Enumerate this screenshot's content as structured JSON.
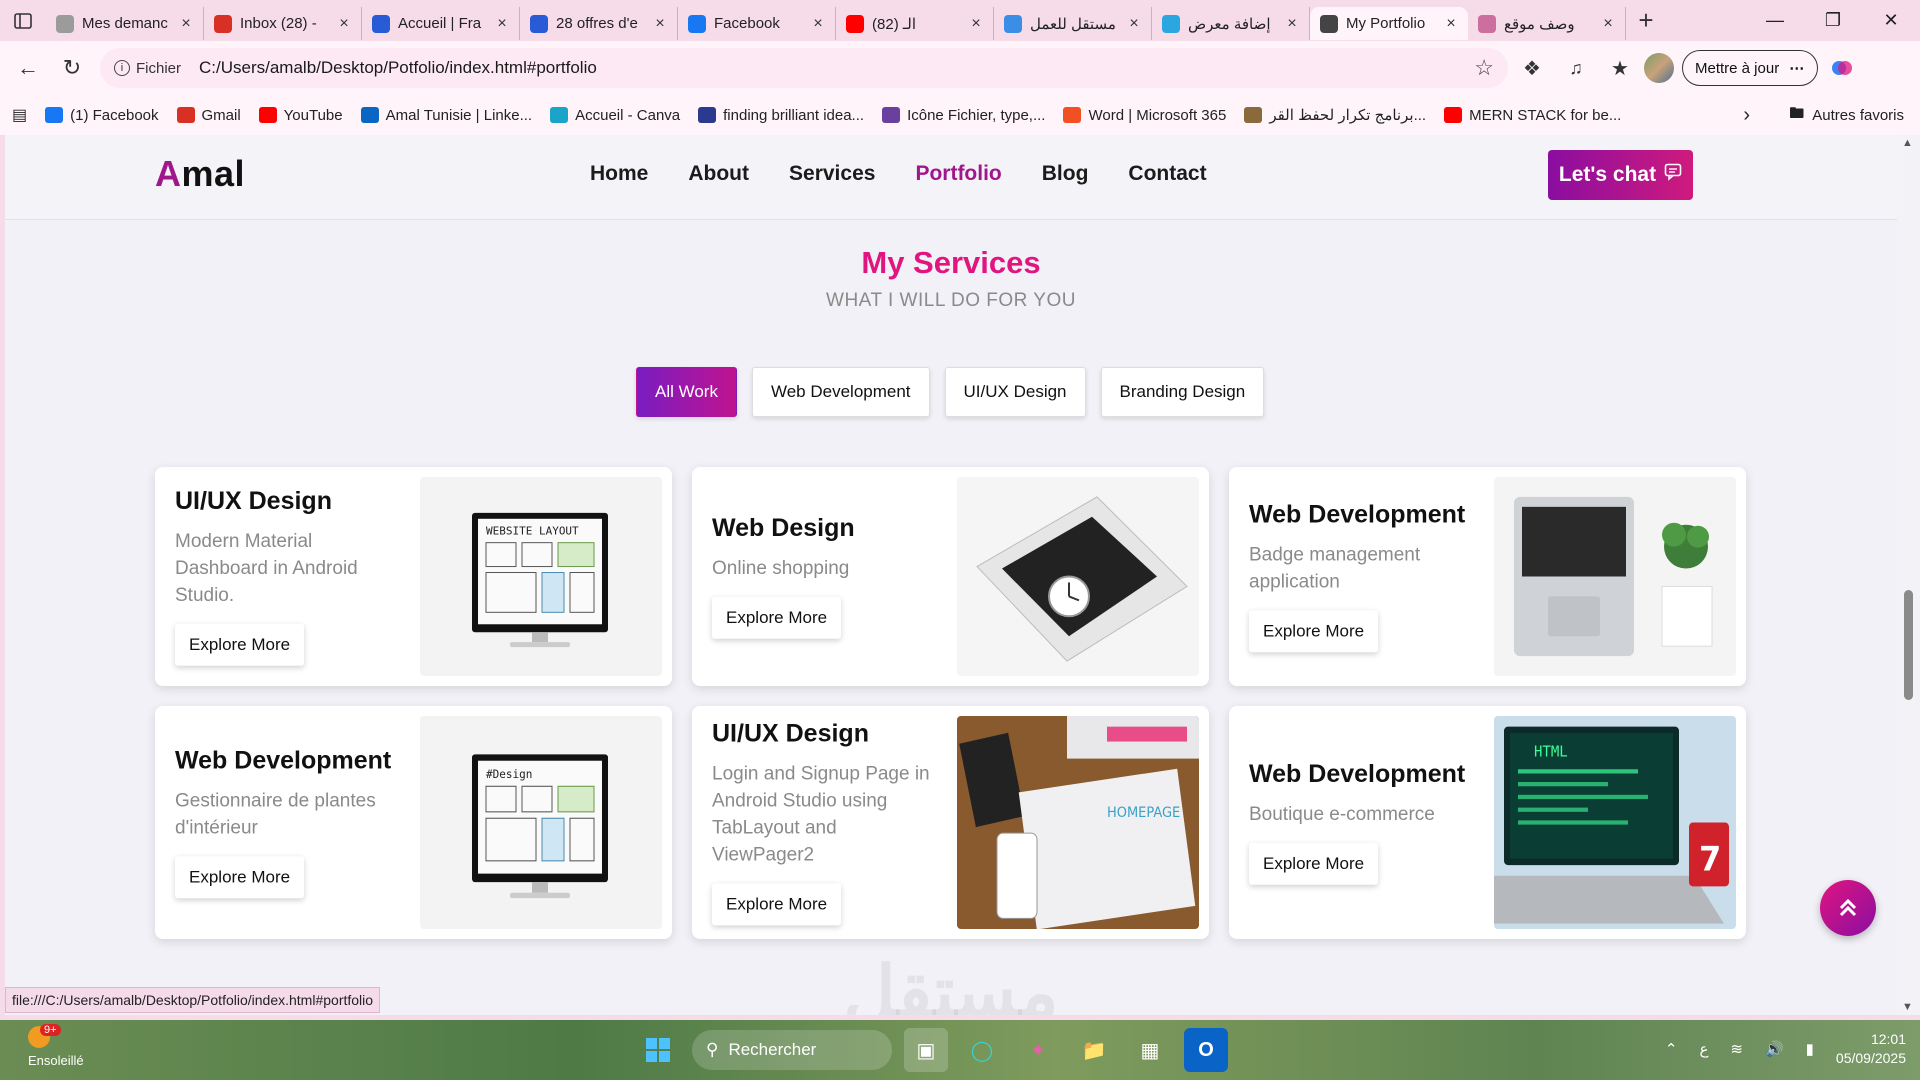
{
  "browser": {
    "tabs": [
      {
        "title": "Mes demanc",
        "icon": "settings-tab-icon",
        "color": "#9b9b9b"
      },
      {
        "title": "Inbox (28) -",
        "icon": "gmail-icon",
        "color": "#d93025"
      },
      {
        "title": "Accueil | Fra",
        "icon": "network-icon",
        "color": "#2a5bd7"
      },
      {
        "title": "28 offres d'e",
        "icon": "network-icon",
        "color": "#2a5bd7"
      },
      {
        "title": "Facebook",
        "icon": "facebook-icon",
        "color": "#1877f2"
      },
      {
        "title": "الـ (82)",
        "icon": "youtube-icon",
        "color": "#ff0000"
      },
      {
        "title": "مستقل للعمل",
        "icon": "search-icon",
        "color": "#3a8ee6"
      },
      {
        "title": "إضافة معرض",
        "icon": "globe-tab-icon",
        "color": "#2aa6e0"
      },
      {
        "title": "My Portfolio",
        "icon": "globe-icon",
        "color": "#444444"
      },
      {
        "title": "وصف موقع",
        "icon": "openai-icon",
        "color": "#cc6f9e"
      }
    ],
    "active_tab_index": 8,
    "address": {
      "scheme_label": "Fichier",
      "url": "C:/Users/amalb/Desktop/Potfolio/index.html#portfolio"
    },
    "update_button": "Mettre à jour",
    "bookmarks": [
      {
        "label": "(1) Facebook",
        "color": "#1877f2"
      },
      {
        "label": "Gmail",
        "color": "#d93025"
      },
      {
        "label": "YouTube",
        "color": "#ff0000"
      },
      {
        "label": "Amal Tunisie | Linke...",
        "color": "#0a66c2"
      },
      {
        "label": "Accueil - Canva",
        "color": "#1aa4c8"
      },
      {
        "label": "finding brilliant idea...",
        "color": "#2b3a8f"
      },
      {
        "label": "Icône Fichier, type,...",
        "color": "#6b3fa0"
      },
      {
        "label": "Word | Microsoft 365",
        "color": "#f25022"
      },
      {
        "label": "برنامج تكرار لحفظ القر...",
        "color": "#8a6a3a"
      },
      {
        "label": "MERN STACK for be...",
        "color": "#ff0000"
      }
    ],
    "other_bookmarks": "Autres favoris",
    "status_url": "file:///C:/Users/amalb/Desktop/Potfolio/index.html#portfolio"
  },
  "site": {
    "logo_first": "A",
    "logo_rest": "mal",
    "nav": [
      "Home",
      "About",
      "Services",
      "Portfolio",
      "Blog",
      "Contact"
    ],
    "nav_active": "Portfolio",
    "chat_button": "Let's chat",
    "section_title": "My Services",
    "section_subtitle": "WHAT I WILL DO FOR YOU",
    "filters": [
      "All Work",
      "Web Development",
      "UI/UX Design",
      "Branding Design"
    ],
    "active_filter": "All Work",
    "explore_label": "Explore More",
    "cards": [
      {
        "title": "UI/UX Design",
        "desc": "Modern Material Dashboard in Android Studio.",
        "image": "website-layout-monitor"
      },
      {
        "title": "Web Design",
        "desc": "Online shopping",
        "image": "laptop-watch"
      },
      {
        "title": "Web Development",
        "desc": "Badge management application",
        "image": "laptop-plant"
      },
      {
        "title": "Web Development",
        "desc": "Gestionnaire de plantes d'intérieur",
        "image": "design-monitor"
      },
      {
        "title": "UI/UX Design",
        "desc": "Login and Signup Page in Android Studio using TabLayout and ViewPager2",
        "image": "desk-sketches"
      },
      {
        "title": "Web Development",
        "desc": "Boutique e-commerce",
        "image": "html-laptop"
      }
    ],
    "watermark": "مستقل",
    "accent_color": "#e0157f",
    "brand_purple": "#a0168c"
  },
  "taskbar": {
    "weather_badge": "9+",
    "weather_label": "Ensoleillé",
    "search_placeholder": "Rechercher",
    "lang": "ع",
    "time": "12:01",
    "date": "05/09/2025"
  }
}
